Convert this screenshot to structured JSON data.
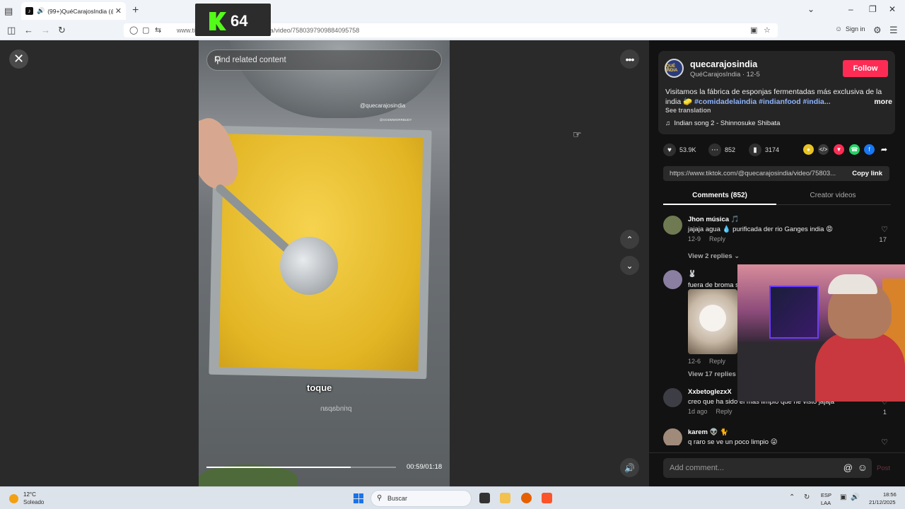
{
  "browser": {
    "tab_title": "(99+)QuéCarajosIndia (@q",
    "url": "www.tiktok.com/@quecarajosindia/video/7580397909884095758",
    "sign_in": "Sign in"
  },
  "kick_overlay": {
    "count": "64"
  },
  "video": {
    "search_placeholder": "Find related content",
    "watermark": "@quecarajosindia",
    "watermark_small": "@GODMWORRBUDY",
    "caption": "toque",
    "caption_mirror": "prindapan",
    "timecode": "00:59/01:18",
    "progress": 0.76
  },
  "post": {
    "username": "quecarajosindia",
    "nickname": "QuéCarajosIndia · 12-5",
    "avatar_text": "QUÉ INDIA",
    "follow": "Follow",
    "desc_text": "Visitamos la fábrica de esponjas fermentadas más exclusiva de la india 🧽 ",
    "desc_tags": "#comidadelaindia #indianfood #india...",
    "desc_more": "more",
    "see_translation": "See translation",
    "music": "Indian song 2 - Shinnosuke Shibata",
    "likes": "53.9K",
    "comments_count": "852",
    "saves": "3174",
    "link": "https://www.tiktok.com/@quecarajosindia/video/75803...",
    "copy_link": "Copy link",
    "tab_comments": "Comments (852)",
    "tab_creator": "Creator videos"
  },
  "comments": [
    {
      "name": "Jhon música 🎵",
      "text": "jajaja agua 💧 purificada der rio Ganges india 😡",
      "date": "12-9",
      "reply": "Reply",
      "likes": "17",
      "view_replies": "View 2 replies ⌄"
    },
    {
      "name": "🐰",
      "text": "fuera de broma s",
      "date": "12-6",
      "reply": "Reply",
      "likes": "",
      "view_replies": "View 17 replies"
    },
    {
      "name": "XxbetoglezxX",
      "text": "creo que ha sido el más limpio que he visto jajaja",
      "date": "1d ago",
      "reply": "Reply",
      "likes": "1",
      "view_replies": ""
    },
    {
      "name": "karem 👽 🐈",
      "text": "q raro se ve un poco limpio 😜",
      "date": "",
      "reply": "",
      "likes": "",
      "view_replies": ""
    }
  ],
  "add_comment": {
    "placeholder": "Add comment...",
    "post": "Post"
  },
  "taskbar": {
    "temp": "12°C",
    "weather": "Soleado",
    "search": "Buscar",
    "lang1": "ESP",
    "lang2": "LAA",
    "time": "18:56",
    "date": "21/12/2025"
  },
  "colors": {
    "follow": "#fe2c55",
    "hashtag": "#8eb5ff",
    "kick_green": "#53fc18"
  }
}
